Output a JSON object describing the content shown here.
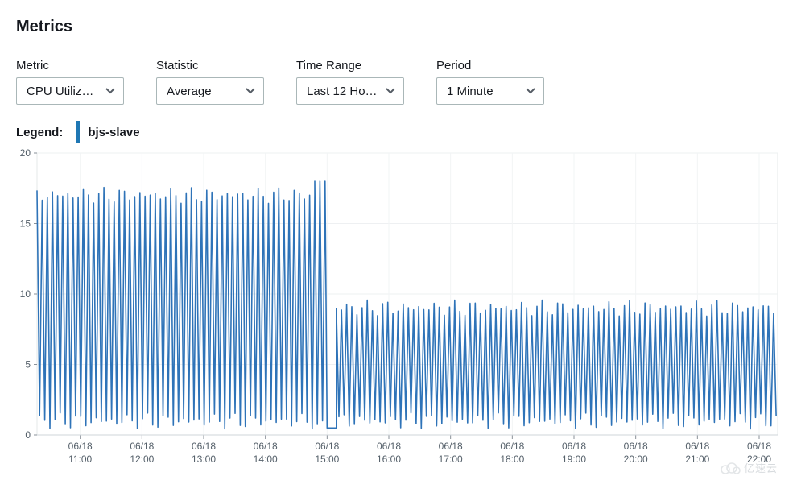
{
  "title": "Metrics",
  "controls": {
    "metric": {
      "label": "Metric",
      "value": "CPU Utiliz…"
    },
    "statistic": {
      "label": "Statistic",
      "value": "Average"
    },
    "timerange": {
      "label": "Time Range",
      "value": "Last 12 Ho…"
    },
    "period": {
      "label": "Period",
      "value": "1 Minute"
    }
  },
  "legend": {
    "label": "Legend:",
    "series": "bjs-slave",
    "color": "#2e73b8"
  },
  "watermark": "亿速云",
  "chart_data": {
    "type": "line",
    "title": "",
    "xlabel": "",
    "ylabel": "",
    "ylim": [
      0,
      20
    ],
    "y_ticks": [
      0,
      5,
      10,
      15,
      20
    ],
    "x_ticks": [
      {
        "date": "06/18",
        "time": "11:00"
      },
      {
        "date": "06/18",
        "time": "12:00"
      },
      {
        "date": "06/18",
        "time": "13:00"
      },
      {
        "date": "06/18",
        "time": "14:00"
      },
      {
        "date": "06/18",
        "time": "15:00"
      },
      {
        "date": "06/18",
        "time": "16:00"
      },
      {
        "date": "06/18",
        "time": "17:00"
      },
      {
        "date": "06/18",
        "time": "18:00"
      },
      {
        "date": "06/18",
        "time": "19:00"
      },
      {
        "date": "06/18",
        "time": "20:00"
      },
      {
        "date": "06/18",
        "time": "21:00"
      },
      {
        "date": "06/18",
        "time": "22:00"
      }
    ],
    "series": [
      {
        "name": "bjs-slave",
        "color": "#2e73b8",
        "segments": [
          {
            "x_start_hour": 10.3,
            "x_end_hour": 14.8,
            "low": 1,
            "high": 17,
            "period_min": 5
          },
          {
            "x_start_hour": 14.8,
            "x_end_hour": 15.0,
            "low": 0.5,
            "high": 18,
            "period_min": 5,
            "spike": true
          },
          {
            "x_start_hour": 15.0,
            "x_end_hour": 15.15,
            "low": 0.5,
            "high": 1,
            "period_min": 5,
            "flat": true
          },
          {
            "x_start_hour": 15.15,
            "x_end_hour": 22.3,
            "low": 1,
            "high": 9,
            "period_min": 5
          }
        ],
        "note": "Minute-level oscillating CPU utilization; amplitude drops from ~1–17% to ~1–9% at ~15:00."
      }
    ],
    "x_domain_hours": [
      10.3,
      22.3
    ]
  }
}
